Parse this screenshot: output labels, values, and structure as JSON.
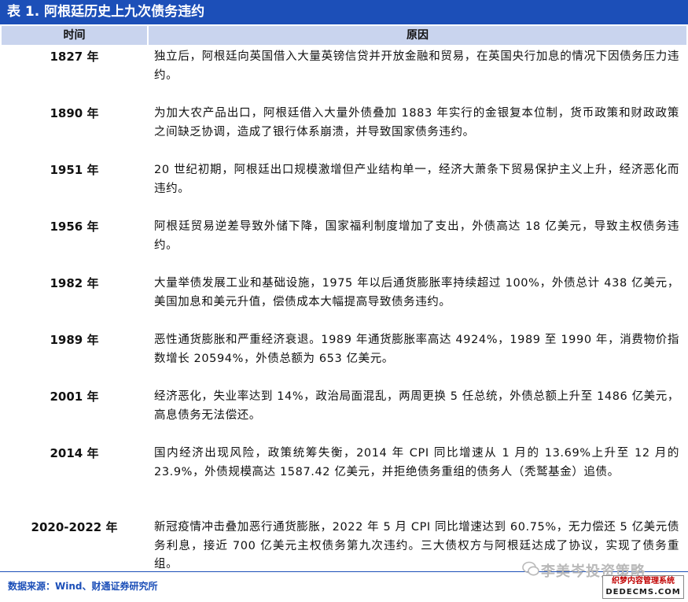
{
  "table": {
    "title": "表 1. 阿根廷历史上九次债务违约",
    "headers": {
      "time": "时间",
      "reason": "原因"
    },
    "rows": [
      {
        "year": "1827 年",
        "reason": "独立后，阿根廷向英国借入大量英镑信贷并开放金融和贸易，在英国央行加息的情况下因债务压力违约。"
      },
      {
        "year": "1890 年",
        "reason": "为加大农产品出口，阿根廷借入大量外债叠加 1883 年实行的金银复本位制，货币政策和财政政策之间缺乏协调，造成了银行体系崩溃，并导致国家债务违约。"
      },
      {
        "year": "1951 年",
        "reason": "20 世纪初期，阿根廷出口规模激增但产业结构单一，经济大萧条下贸易保护主义上升，经济恶化而违约。"
      },
      {
        "year": "1956 年",
        "reason": "阿根廷贸易逆差导致外储下降，国家福利制度增加了支出，外债高达 18 亿美元，导致主权债务违约。"
      },
      {
        "year": "1982 年",
        "reason": "大量举债发展工业和基础设施，1975 年以后通货膨胀率持续超过 100%，外债总计 438 亿美元，美国加息和美元升值，偿债成本大幅提高导致债务违约。"
      },
      {
        "year": "1989 年",
        "reason": "恶性通货膨胀和严重经济衰退。1989 年通货膨胀率高达 4924%，1989 至 1990 年，消费物价指数增长 20594%，外债总额为 653 亿美元。"
      },
      {
        "year": "2001 年",
        "reason": "经济恶化，失业率达到 14%，政治局面混乱，两周更换 5 任总统，外债总额上升至 1486 亿美元，高息债务无法偿还。"
      },
      {
        "year": "2014 年",
        "reason": "国内经济出现风险，政策统筹失衡，2014 年 CPI 同比增速从 1 月的 13.69%上升至 12 月的 23.9%，外债规模高达 1587.42 亿美元，并拒绝债务重组的债务人（秃鹫基金）追债。"
      },
      {
        "year": "2020-2022 年",
        "reason": "新冠疫情冲击叠加恶行通货膨胀，2022 年 5 月 CPI 同比增速达到 60.75%，无力偿还 5 亿美元债务利息，接近 700 亿美元主权债务第九次违约。三大债权方与阿根廷达成了协议，实现了债务重组。"
      }
    ]
  },
  "source": "数据来源：Wind、财通证券研究所",
  "watermark": {
    "account": "李美岑投资策略",
    "site_cn": "织梦内容管理系统",
    "site": "DEDECMS.COM"
  },
  "colors": {
    "title_bg": "#1c4fb8",
    "header_bg": "#c9d4ee",
    "source_text": "#1c4fb8"
  }
}
